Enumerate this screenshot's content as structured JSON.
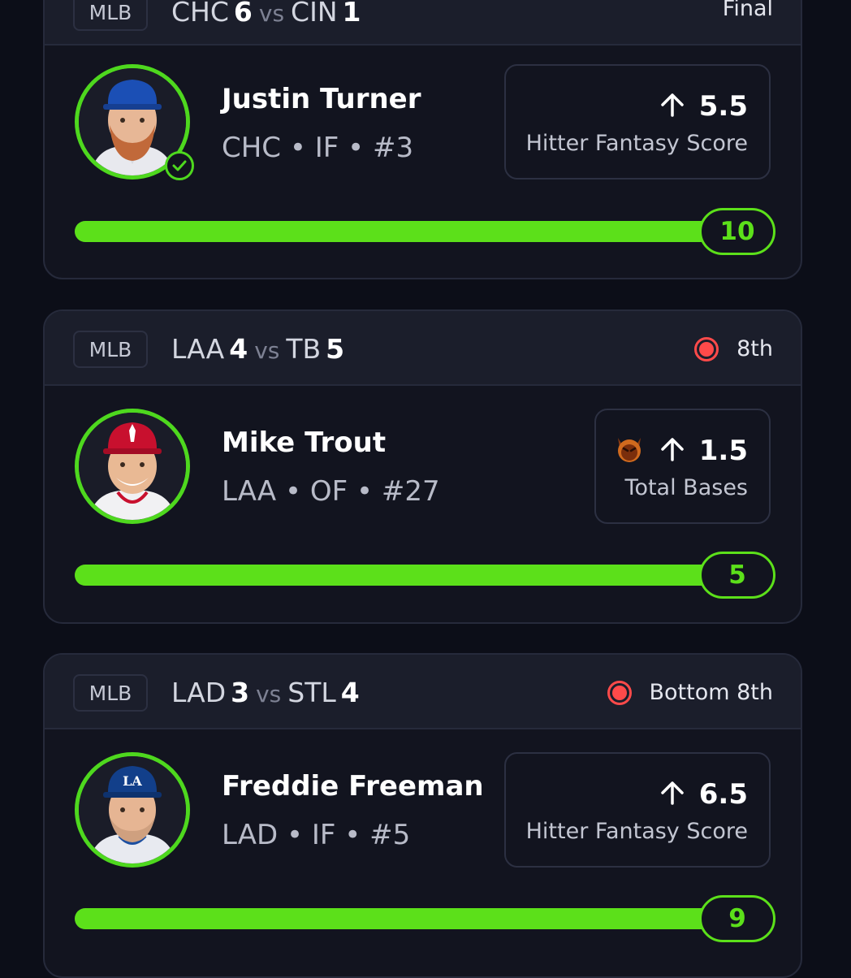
{
  "cards": [
    {
      "league": "MLB",
      "away_team": "CHC",
      "away_score": "6",
      "vs": "vs",
      "home_team": "CIN",
      "home_score": "1",
      "status": "Final",
      "player_name": "Justin Turner",
      "player_meta": "CHC • IF • #3",
      "stat_value": "5.5",
      "stat_label": "Hitter Fantasy Score",
      "progress_value": "10",
      "progress_fraction": 1.0,
      "avatar_icon": "player-photo-icon",
      "cap_color": "#1b4fb5",
      "verified": true
    },
    {
      "league": "MLB",
      "away_team": "LAA",
      "away_score": "4",
      "vs": "vs",
      "home_team": "TB",
      "home_score": "5",
      "status": "8th",
      "player_name": "Mike Trout",
      "player_meta": "LAA • OF • #27",
      "stat_value": "1.5",
      "stat_label": "Total Bases",
      "progress_value": "5",
      "progress_fraction": 1.0,
      "avatar_icon": "player-photo-icon",
      "cap_color": "#c8102e",
      "demon_icon": "demon-emoji-icon"
    },
    {
      "league": "MLB",
      "away_team": "LAD",
      "away_score": "3",
      "vs": "vs",
      "home_team": "STL",
      "home_score": "4",
      "status": "Bottom 8th",
      "player_name": "Freddie Freeman",
      "player_meta": "LAD • IF • #5",
      "stat_value": "6.5",
      "stat_label": "Hitter Fantasy Score",
      "progress_value": "9",
      "progress_fraction": 1.0,
      "avatar_icon": "player-photo-icon",
      "cap_color": "#123f8a"
    }
  ],
  "colors": {
    "accent_green": "#5ce01a",
    "live_red": "#ff4a4a",
    "background": "#0c0e18"
  }
}
